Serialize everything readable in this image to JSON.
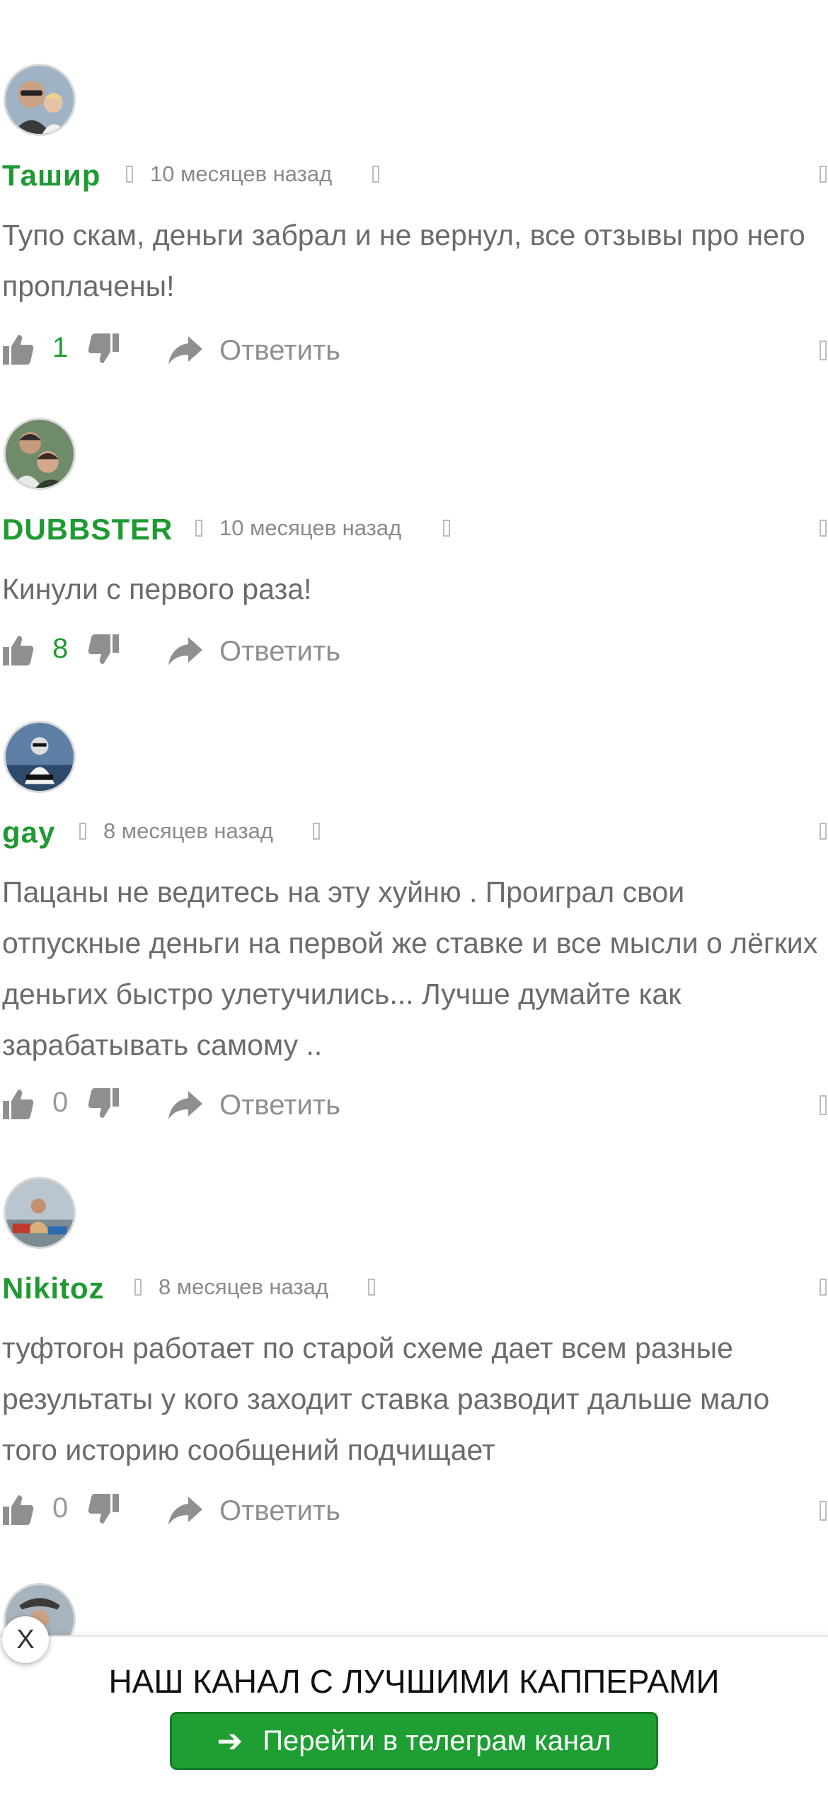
{
  "comments": [
    {
      "author": "Ташир",
      "date": "10 месяцев назад",
      "text": "Тупо скам, деньги забрал и не вернул, все отзывы про него проплачены!",
      "votes": "1",
      "reply_label": "Ответить"
    },
    {
      "author": "DUBBSTER",
      "date": "10 месяцев назад",
      "text": "Кинули с первого раза!",
      "votes": "8",
      "reply_label": "Ответить"
    },
    {
      "author": "gay",
      "date": "8 месяцев назад",
      "text": "Пацаны не ведитесь на эту хуйню . Проиграл свои отпускные деньги на первой же ставке и все мысли о лёгких деньгих быстро улетучились... Лучше думайте как зарабатывать самому ..",
      "votes": "0",
      "reply_label": "Ответить"
    },
    {
      "author": "Nikitoz",
      "date": "8 месяцев назад",
      "text": "туфтогон работает по старой схеме дает всем разные результаты у кого заходит ставка разводит дальше мало того историю сообщений подчищает",
      "votes": "0",
      "reply_label": "Ответить"
    }
  ],
  "promo": {
    "title": "НАШ КАНАЛ С ЛУЧШИМИ КАППЕРАМИ",
    "button_label": "Перейти в телеграм канал",
    "close_label": "X"
  },
  "colors": {
    "accent_green": "#1f9a32",
    "text_gray": "#6b6b6b",
    "button_green": "#1f9e34"
  },
  "icons": [
    "like-icon",
    "dislike-icon",
    "reply-icon",
    "close-icon",
    "arrow-right-icon"
  ]
}
